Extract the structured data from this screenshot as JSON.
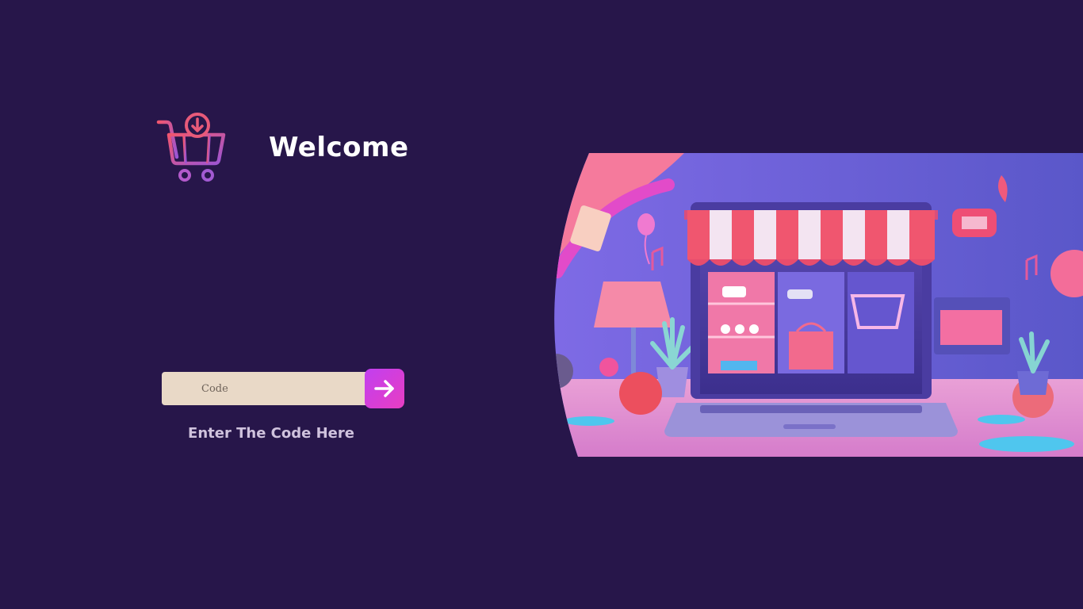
{
  "header": {
    "title": "Welcome"
  },
  "form": {
    "code_placeholder": "Code",
    "code_value": "",
    "hint": "Enter The Code Here"
  },
  "icons": {
    "logo": "shopping-cart-download-icon",
    "submit": "arrow-right-icon"
  },
  "colors": {
    "background": "#27164a",
    "input_bg": "#e9d9c7",
    "accent_start": "#c13ff0",
    "accent_end": "#e83ec2",
    "hint_text": "#cfc2dd"
  }
}
